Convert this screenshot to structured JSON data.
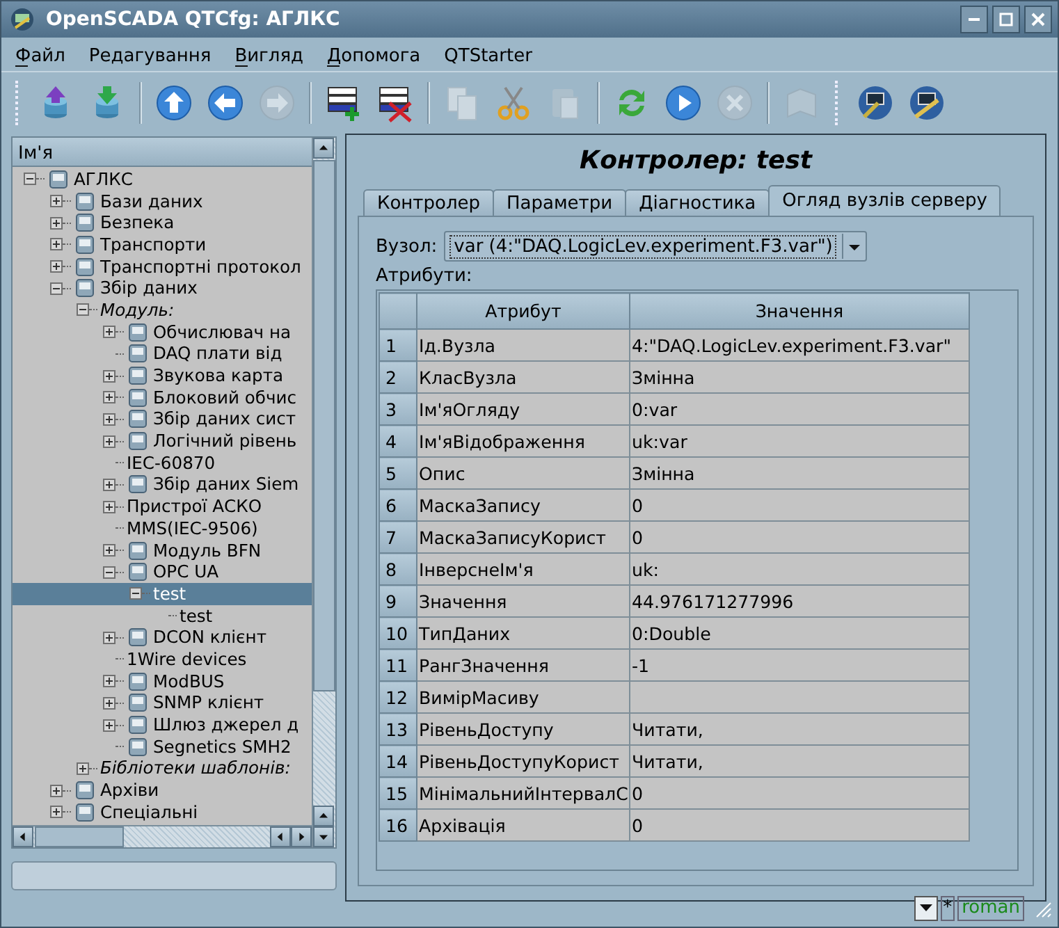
{
  "window": {
    "title": "OpenSCADA QTCfg: АГЛКС"
  },
  "menu": [
    {
      "label": "Файл",
      "mnemonic": true
    },
    {
      "label": "Редагування",
      "mnemonic": false
    },
    {
      "label": "Вигляд",
      "mnemonic": true
    },
    {
      "label": "Допомога",
      "mnemonic": true
    },
    {
      "label": "QTStarter",
      "mnemonic": false
    }
  ],
  "toolbar": [
    [
      {
        "disabled": false
      },
      {
        "disabled": false
      }
    ],
    [
      {
        "disabled": false
      },
      {
        "disabled": false
      },
      {
        "disabled": true
      }
    ],
    [
      {
        "disabled": false
      },
      {
        "disabled": false
      }
    ],
    [
      {
        "disabled": true
      },
      {
        "disabled": false
      },
      {
        "disabled": true
      }
    ],
    [
      {
        "disabled": false
      },
      {
        "disabled": false
      },
      {
        "disabled": true
      }
    ],
    [
      {
        "disabled": true
      }
    ],
    [
      {
        "disabled": false
      },
      {
        "disabled": false
      }
    ]
  ],
  "tree": {
    "header": "Ім'я",
    "items": [
      {
        "label": "АГЛКС",
        "kind": "node",
        "icon": true,
        "expandable": true,
        "expanded": true,
        "selected": false,
        "children": [
          {
            "label": "Бази даних",
            "kind": "node",
            "icon": true,
            "expandable": true,
            "expanded": false,
            "selected": false
          },
          {
            "label": "Безпека",
            "kind": "node",
            "icon": true,
            "expandable": true,
            "expanded": false,
            "selected": false
          },
          {
            "label": "Транспорти",
            "kind": "node",
            "icon": true,
            "expandable": true,
            "expanded": false,
            "selected": false
          },
          {
            "label": "Транспортні протокол",
            "kind": "node",
            "icon": true,
            "expandable": true,
            "expanded": false,
            "selected": false
          },
          {
            "label": "Збір даних",
            "kind": "node",
            "icon": true,
            "expandable": true,
            "expanded": true,
            "selected": false,
            "children": [
              {
                "label": "Модуль:",
                "kind": "group",
                "icon": false,
                "expandable": true,
                "expanded": true,
                "selected": false,
                "children": [
                  {
                    "label": "Обчислювач на",
                    "kind": "node",
                    "icon": true,
                    "expandable": true,
                    "expanded": false,
                    "selected": false
                  },
                  {
                    "label": "DAQ плати від",
                    "kind": "node",
                    "icon": true,
                    "expandable": false,
                    "expanded": false,
                    "selected": false
                  },
                  {
                    "label": "Звукова карта",
                    "kind": "node",
                    "icon": true,
                    "expandable": true,
                    "expanded": false,
                    "selected": false
                  },
                  {
                    "label": "Блоковий обчис",
                    "kind": "node",
                    "icon": true,
                    "expandable": true,
                    "expanded": false,
                    "selected": false
                  },
                  {
                    "label": "Збір даних сист",
                    "kind": "node",
                    "icon": true,
                    "expandable": true,
                    "expanded": false,
                    "selected": false
                  },
                  {
                    "label": "Логічний рівень",
                    "kind": "node",
                    "icon": true,
                    "expandable": true,
                    "expanded": false,
                    "selected": false
                  },
                  {
                    "label": "IEC-60870",
                    "kind": "node",
                    "icon": false,
                    "expandable": false,
                    "expanded": false,
                    "selected": false
                  },
                  {
                    "label": "Збір даних Siem",
                    "kind": "node",
                    "icon": true,
                    "expandable": true,
                    "expanded": false,
                    "selected": false
                  },
                  {
                    "label": "Пристрої АСКО",
                    "kind": "node",
                    "icon": false,
                    "expandable": true,
                    "expanded": false,
                    "selected": false
                  },
                  {
                    "label": "MMS(IEC-9506)",
                    "kind": "node",
                    "icon": false,
                    "expandable": false,
                    "expanded": false,
                    "selected": false
                  },
                  {
                    "label": "Модуль BFN",
                    "kind": "node",
                    "icon": true,
                    "expandable": true,
                    "expanded": false,
                    "selected": false
                  },
                  {
                    "label": "OPC UA",
                    "kind": "node",
                    "icon": true,
                    "expandable": true,
                    "expanded": true,
                    "selected": false,
                    "children": [
                      {
                        "label": "test",
                        "kind": "node",
                        "icon": false,
                        "expandable": true,
                        "expanded": true,
                        "selected": true,
                        "children": [
                          {
                            "label": "test",
                            "kind": "node",
                            "icon": false,
                            "expandable": false,
                            "expanded": false,
                            "selected": false
                          }
                        ]
                      }
                    ]
                  },
                  {
                    "label": "DCON клієнт",
                    "kind": "node",
                    "icon": true,
                    "expandable": true,
                    "expanded": false,
                    "selected": false
                  },
                  {
                    "label": "1Wire devices",
                    "kind": "node",
                    "icon": false,
                    "expandable": false,
                    "expanded": false,
                    "selected": false
                  },
                  {
                    "label": "ModBUS",
                    "kind": "node",
                    "icon": true,
                    "expandable": true,
                    "expanded": false,
                    "selected": false
                  },
                  {
                    "label": "SNMP клієнт",
                    "kind": "node",
                    "icon": true,
                    "expandable": true,
                    "expanded": false,
                    "selected": false
                  },
                  {
                    "label": "Шлюз джерел д",
                    "kind": "node",
                    "icon": true,
                    "expandable": true,
                    "expanded": false,
                    "selected": false
                  },
                  {
                    "label": "Segnetics SMH2",
                    "kind": "node",
                    "icon": true,
                    "expandable": false,
                    "expanded": false,
                    "selected": false
                  }
                ]
              },
              {
                "label": "Бібліотеки шаблонів:",
                "kind": "group",
                "icon": false,
                "expandable": true,
                "expanded": false,
                "selected": false
              }
            ]
          },
          {
            "label": "Архіви",
            "kind": "node",
            "icon": true,
            "expandable": true,
            "expanded": false,
            "selected": false
          },
          {
            "label": "Спеціальні",
            "kind": "node",
            "icon": true,
            "expandable": true,
            "expanded": false,
            "selected": false
          }
        ]
      }
    ]
  },
  "page": {
    "title": "Контролер: test",
    "tabs": [
      {
        "label": "Контролер",
        "selected": false
      },
      {
        "label": "Параметри",
        "selected": false
      },
      {
        "label": "Діагностика",
        "selected": false
      },
      {
        "label": "Огляд вузлів серверу",
        "selected": true
      }
    ],
    "node_label": "Вузол:",
    "node_value": "var (4:\"DAQ.LogicLev.experiment.F3.var\")",
    "attributes_label": "Атрибути:",
    "table": {
      "columns": [
        "Атрибут",
        "Значення"
      ],
      "rows": [
        {
          "n": "1",
          "attr": "Ід.Вузла",
          "value": "4:\"DAQ.LogicLev.experiment.F3.var\""
        },
        {
          "n": "2",
          "attr": "КласВузла",
          "value": "Змінна"
        },
        {
          "n": "3",
          "attr": "Ім'яОгляду",
          "value": "0:var"
        },
        {
          "n": "4",
          "attr": "Ім'яВідображення",
          "value": "uk:var"
        },
        {
          "n": "5",
          "attr": "Опис",
          "value": "Змінна"
        },
        {
          "n": "6",
          "attr": "МаскаЗапису",
          "value": "0"
        },
        {
          "n": "7",
          "attr": "МаскаЗаписуКорист",
          "value": "0"
        },
        {
          "n": "8",
          "attr": "ІнверснеІм'я",
          "value": "uk:"
        },
        {
          "n": "9",
          "attr": "Значення",
          "value": "44.976171277996"
        },
        {
          "n": "10",
          "attr": "ТипДаних",
          "value": "0:Double"
        },
        {
          "n": "11",
          "attr": "РангЗначення",
          "value": "-1"
        },
        {
          "n": "12",
          "attr": "ВимірМасиву",
          "value": ""
        },
        {
          "n": "13",
          "attr": "РівеньДоступу",
          "value": "Читати,"
        },
        {
          "n": "14",
          "attr": "РівеньДоступуКорист",
          "value": "Читати,"
        },
        {
          "n": "15",
          "attr": "МінімальнийІнтервалС",
          "value": "0"
        },
        {
          "n": "16",
          "attr": "Архівація",
          "value": "0"
        }
      ]
    }
  },
  "status_bar": {
    "star": "*",
    "user": "roman"
  }
}
